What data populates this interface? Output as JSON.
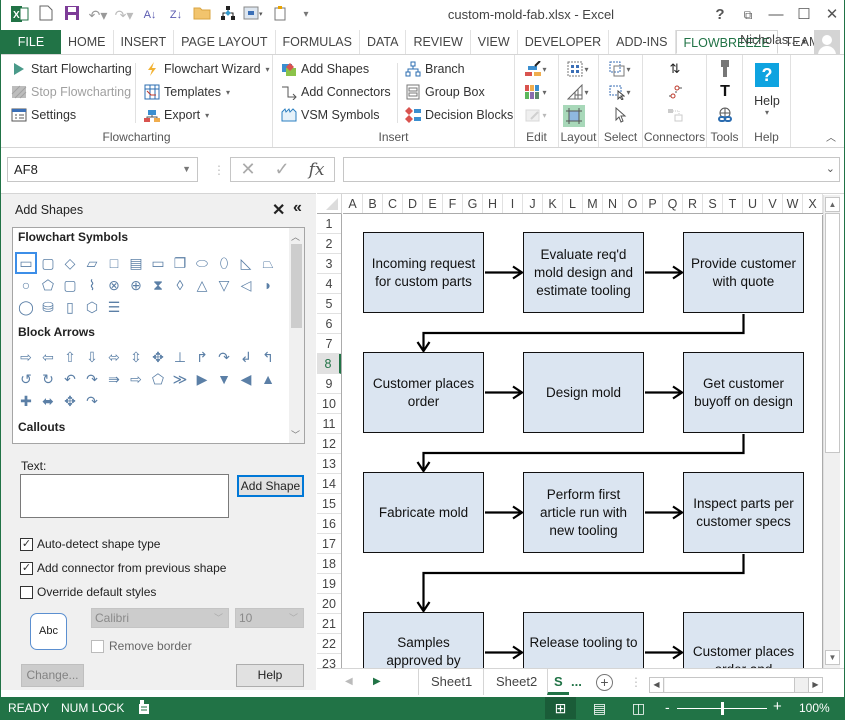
{
  "window": {
    "title": "custom-mold-fab.xlsx - Excel",
    "controls": [
      "help-icon",
      "ribbon-display-icon",
      "minimize-icon",
      "maximize-icon",
      "close-icon"
    ],
    "quick_access": [
      "excel-logo-icon",
      "new-file-icon",
      "save-icon",
      "undo-icon",
      "redo-icon",
      "sort-ascending-icon",
      "sort-descending-icon",
      "open-folder-icon",
      "org-chart-icon",
      "table-icon",
      "paste-icon",
      "customize-icon"
    ]
  },
  "tabs": [
    "FILE",
    "HOME",
    "INSERT",
    "PAGE LAYOUT",
    "FORMULAS",
    "DATA",
    "REVIEW",
    "VIEW",
    "DEVELOPER",
    "ADD-INS",
    "FLOWBREEZE",
    "TEAM"
  ],
  "active_tab": "FLOWBREEZE",
  "user": {
    "name": "Nicholas..."
  },
  "ribbon": {
    "flowcharting": {
      "label": "Flowcharting",
      "start": "Start Flowcharting",
      "stop": "Stop Flowcharting",
      "settings": "Settings",
      "wizard": "Flowchart Wizard",
      "templates": "Templates",
      "export": "Export"
    },
    "insert": {
      "label": "Insert",
      "add_shapes": "Add Shapes",
      "add_connectors": "Add Connectors",
      "vsm_symbols": "VSM Symbols",
      "branch": "Branch",
      "group_box": "Group Box",
      "decision_blocks": "Decision Blocks"
    },
    "edit": {
      "label": "Edit"
    },
    "layout": {
      "label": "Layout"
    },
    "select": {
      "label": "Select"
    },
    "connectors": {
      "label": "Connectors"
    },
    "tools": {
      "label": "Tools"
    },
    "help": {
      "label": "Help",
      "button": "Help",
      "icon_text": "?"
    }
  },
  "formula_bar": {
    "name_box": "AF8",
    "fx": "fx",
    "cancel": "✕",
    "enter": "✓",
    "value": ""
  },
  "pane": {
    "title": "Add Shapes",
    "close": "✕",
    "collapse": "«",
    "sections": {
      "flowchart": "Flowchart Symbols",
      "arrows": "Block Arrows",
      "callouts": "Callouts"
    },
    "flowchart_symbols": [
      [
        "▭",
        "▢",
        "◇",
        "▱",
        "□",
        "▤",
        "▭",
        "❐",
        "⬭",
        "⬯",
        "◺",
        "⏢"
      ],
      [
        "○",
        "⬠",
        "▢",
        "⌇",
        "⊗",
        "⊕",
        "⧗",
        "◊",
        "△",
        "▽",
        "◁",
        "◗"
      ],
      [
        "◯",
        "⛁",
        "▯",
        "⬡",
        "☰"
      ]
    ],
    "block_arrows": [
      [
        "⇨",
        "⇦",
        "⇧",
        "⇩",
        "⬄",
        "⇳",
        "✥",
        "⊥",
        "↱",
        "↷",
        "↲",
        "↰"
      ],
      [
        "↺",
        "↻",
        "↶",
        "↷",
        "⇛",
        "⇨",
        "⬠",
        "≫",
        "▶",
        "▼",
        "◀",
        "▲"
      ],
      [
        "✚",
        "⬌",
        "✥",
        "↷"
      ]
    ],
    "text_label": "Text:",
    "text_value": "",
    "add_shape_button": "Add Shape",
    "options": [
      {
        "label": "Auto-detect shape type",
        "checked": true
      },
      {
        "label": "Add connector from previous shape",
        "checked": true
      },
      {
        "label": "Override default styles",
        "checked": false
      }
    ],
    "style_preview": "Abc",
    "font": "Calibri",
    "font_size": "10",
    "remove_border": {
      "label": "Remove border",
      "checked": false
    },
    "change_button": "Change...",
    "help_button": "Help"
  },
  "sheet": {
    "columns": [
      "A",
      "B",
      "C",
      "D",
      "E",
      "F",
      "G",
      "H",
      "I",
      "J",
      "K",
      "L",
      "M",
      "N",
      "O",
      "P",
      "Q",
      "R",
      "S",
      "T",
      "U",
      "V",
      "W",
      "X"
    ],
    "rows": [
      "1",
      "2",
      "3",
      "4",
      "5",
      "6",
      "7",
      "8",
      "9",
      "10",
      "11",
      "12",
      "13",
      "14",
      "15",
      "16",
      "17",
      "18",
      "19",
      "20",
      "21",
      "22",
      "23"
    ],
    "active_row": "8",
    "flowchart": [
      [
        "Incoming request for custom parts",
        "Evaluate req'd mold design and estimate tooling",
        "Provide customer with quote"
      ],
      [
        "Customer places order",
        "Design mold",
        "Get customer buyoff on design"
      ],
      [
        "Fabricate mold",
        "Perform first article run with new tooling",
        "Inspect parts per customer specs"
      ],
      [
        "Samples approved by",
        "Release tooling to",
        "Customer places order and"
      ]
    ]
  },
  "sheet_tabs": {
    "tabs": [
      "Sheet1",
      "Sheet2",
      "S"
    ],
    "active": "S",
    "more": "..."
  },
  "status": {
    "ready": "READY",
    "num_lock": "NUM LOCK",
    "zoom": "100%",
    "zoom_fraction": 0.5
  }
}
